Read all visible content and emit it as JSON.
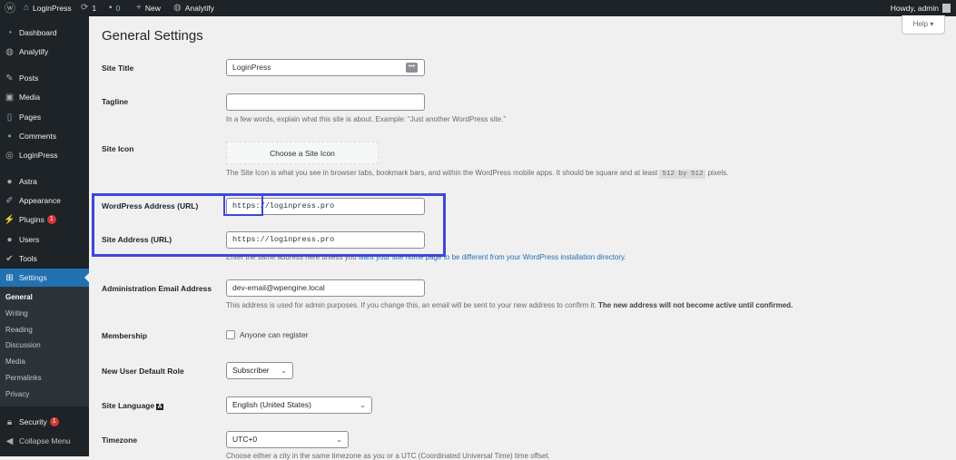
{
  "adminbar": {
    "site": "LoginPress",
    "updates": "1",
    "comments": "0",
    "new": "New",
    "analytify": "Analytify",
    "howdy": "Howdy, admin"
  },
  "sidebar": {
    "items": [
      "Dashboard",
      "Analytify",
      "Posts",
      "Media",
      "Pages",
      "Comments",
      "LoginPress",
      "Astra",
      "Appearance",
      "Plugins",
      "Users",
      "Tools",
      "Settings"
    ],
    "plugins_badge": "1",
    "submenu": [
      "General",
      "Writing",
      "Reading",
      "Discussion",
      "Media",
      "Permalinks",
      "Privacy"
    ],
    "security": "Security",
    "security_badge": "1",
    "collapse": "Collapse Menu"
  },
  "help": "Help ▾",
  "page": {
    "title": "General Settings",
    "site_title": {
      "label": "Site Title",
      "value": "LoginPress"
    },
    "tagline": {
      "label": "Tagline",
      "value": "",
      "help": "In a few words, explain what this site is about. Example: “Just another WordPress site.”"
    },
    "site_icon": {
      "label": "Site Icon",
      "button": "Choose a Site Icon",
      "help_pre": "The Site Icon is what you see in browser tabs, bookmark bars, and within the WordPress mobile apps. It should be square and at least",
      "code": "512 by 512",
      "help_post": "pixels."
    },
    "wp_address": {
      "label": "WordPress Address (URL)",
      "value": "https://loginpress.pro"
    },
    "site_address": {
      "label": "Site Address (URL)",
      "value": "https://loginpress.pro",
      "help_pre": "Enter the same address here unless you ",
      "help_link": "want your site home page to be different from your WordPress installation directory",
      "help_post": "."
    },
    "admin_email": {
      "label": "Administration Email Address",
      "value": "dev-email@wpengine.local",
      "help": "This address is used for admin purposes. If you change this, an email will be sent to your new address to confirm it.",
      "help_bold": "The new address will not become active until confirmed."
    },
    "membership": {
      "label": "Membership",
      "checkbox": "Anyone can register",
      "checked": false
    },
    "role": {
      "label": "New User Default Role",
      "value": "Subscriber"
    },
    "language": {
      "label": "Site Language",
      "value": "English (United States)"
    },
    "timezone": {
      "label": "Timezone",
      "value": "UTC+0",
      "help": "Choose either a city in the same timezone as you or a UTC (Coordinated Universal Time) time offset."
    }
  },
  "highlight_color": "#3f48d8"
}
